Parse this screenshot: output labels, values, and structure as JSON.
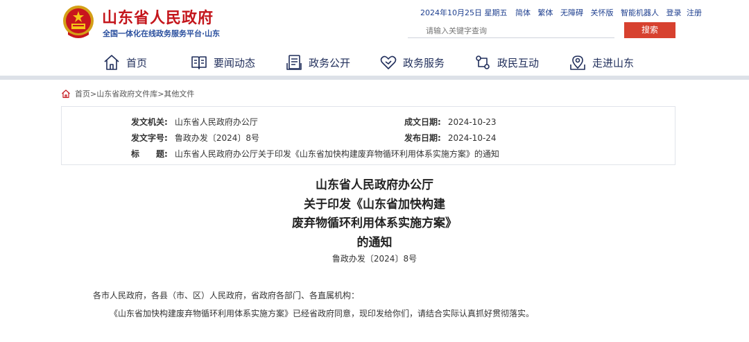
{
  "header": {
    "site_title": "山东省人民政府",
    "site_subtitle": "全国一体化在线政务服务平台·山东",
    "date_text": "2024年10月25日 星期五",
    "top_links": [
      "简体",
      "繁体",
      "无障碍",
      "关怀版",
      "智能机器人",
      "登录",
      "注册"
    ],
    "search_placeholder": "请输入关键字查询",
    "search_button": "搜索"
  },
  "nav": {
    "items": [
      {
        "label": "首页",
        "icon": "home-icon"
      },
      {
        "label": "要闻动态",
        "icon": "book-icon"
      },
      {
        "label": "政务公开",
        "icon": "document-icon"
      },
      {
        "label": "政务服务",
        "icon": "heart-icon"
      },
      {
        "label": "政民互动",
        "icon": "interaction-icon"
      },
      {
        "label": "走进山东",
        "icon": "map-pin-icon"
      }
    ]
  },
  "breadcrumb": {
    "text": "首页>山东省政府文件库>其他文件"
  },
  "info": {
    "issuer_label": "发文机关:",
    "issuer_value": "山东省人民政府办公厅",
    "doc_no_label": "发文字号:",
    "doc_no_value": "鲁政办发〔2024〕8号",
    "subject_label": "标　　题:",
    "subject_value": "山东省人民政府办公厅关于印发《山东省加快构建废弃物循环利用体系实施方案》的通知",
    "created_label": "成文日期:",
    "created_value": "2024-10-23",
    "published_label": "发布日期:",
    "published_value": "2024-10-24"
  },
  "article": {
    "title_lines": [
      "山东省人民政府办公厅",
      "关于印发《山东省加快构建",
      "废弃物循环利用体系实施方案》",
      "的通知"
    ],
    "doc_number": "鲁政办发〔2024〕8号",
    "salutation": "各市人民政府，各县（市、区）人民政府，省政府各部门、各直属机构：",
    "paragraph1": "《山东省加快构建废弃物循环利用体系实施方案》已经省政府同意，现印发给你们，请结合实际认真抓好贯彻落实。"
  },
  "colors": {
    "brand_red": "#c4161c",
    "nav_text": "#1f2d5a",
    "link_blue": "#1e3f8f",
    "search_button": "#d7412f"
  }
}
